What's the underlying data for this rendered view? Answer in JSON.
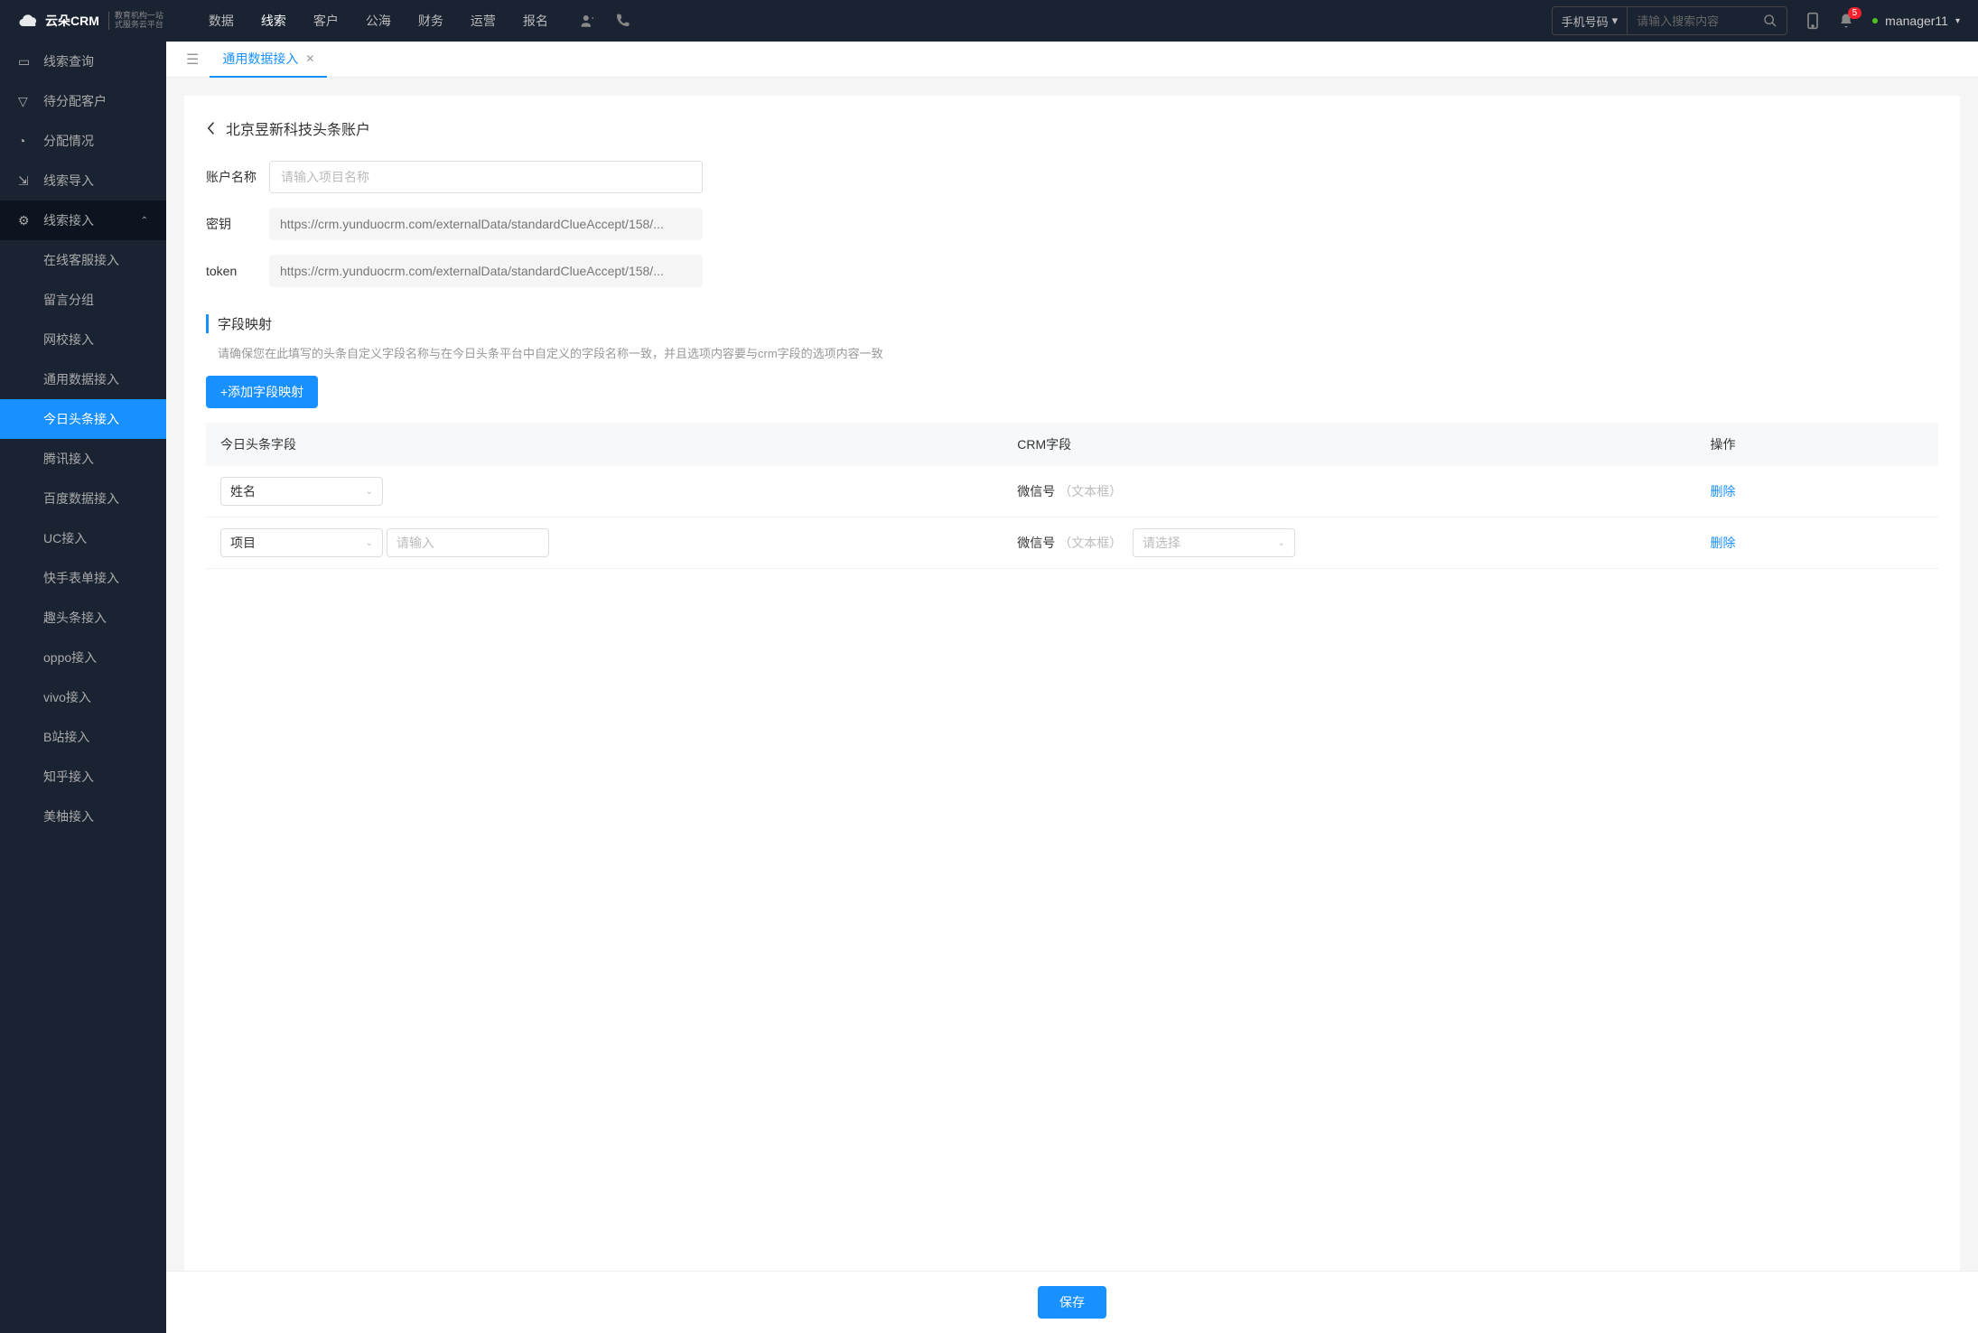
{
  "header": {
    "logo_main": "云朵CRM",
    "logo_sub1": "教育机构一站",
    "logo_sub2": "式服务云平台",
    "nav": [
      "数据",
      "线索",
      "客户",
      "公海",
      "财务",
      "运营",
      "报名"
    ],
    "nav_active_index": 1,
    "search_type": "手机号码",
    "search_placeholder": "请输入搜索内容",
    "notif_count": "5",
    "username": "manager11"
  },
  "sidebar": {
    "items": [
      {
        "label": "线索查询"
      },
      {
        "label": "待分配客户"
      },
      {
        "label": "分配情况"
      },
      {
        "label": "线索导入"
      },
      {
        "label": "线索接入",
        "expanded": true,
        "children": [
          "在线客服接入",
          "留言分组",
          "网校接入",
          "通用数据接入",
          "今日头条接入",
          "腾讯接入",
          "百度数据接入",
          "UC接入",
          "快手表单接入",
          "趣头条接入",
          "oppo接入",
          "vivo接入",
          "B站接入",
          "知乎接入",
          "美柚接入"
        ],
        "active_child_index": 4
      }
    ]
  },
  "tab": {
    "label": "通用数据接入"
  },
  "page": {
    "title": "北京昱新科技头条账户",
    "account_label": "账户名称",
    "account_placeholder": "请输入项目名称",
    "secret_label": "密钥",
    "secret_value": "https://crm.yunduocrm.com/externalData/standardClueAccept/158/...",
    "token_label": "token",
    "token_value": "https://crm.yunduocrm.com/externalData/standardClueAccept/158/...",
    "section_title": "字段映射",
    "section_hint": "请确保您在此填写的头条自定义字段名称与在今日头条平台中自定义的字段名称一致，并且选项内容要与crm字段的选项内容一致",
    "add_btn": "+添加字段映射",
    "columns": {
      "c1": "今日头条字段",
      "c2": "CRM字段",
      "c3": "操作"
    },
    "rows": [
      {
        "field": "姓名",
        "crm_label": "微信号",
        "crm_hint": "（文本框）",
        "extra_input": false,
        "extra_select": false,
        "delete": "删除"
      },
      {
        "field": "项目",
        "crm_label": "微信号",
        "crm_hint": "（文本框）",
        "extra_input": true,
        "extra_input_placeholder": "请输入",
        "extra_select": true,
        "extra_select_placeholder": "请选择",
        "delete": "删除"
      }
    ],
    "save": "保存"
  }
}
